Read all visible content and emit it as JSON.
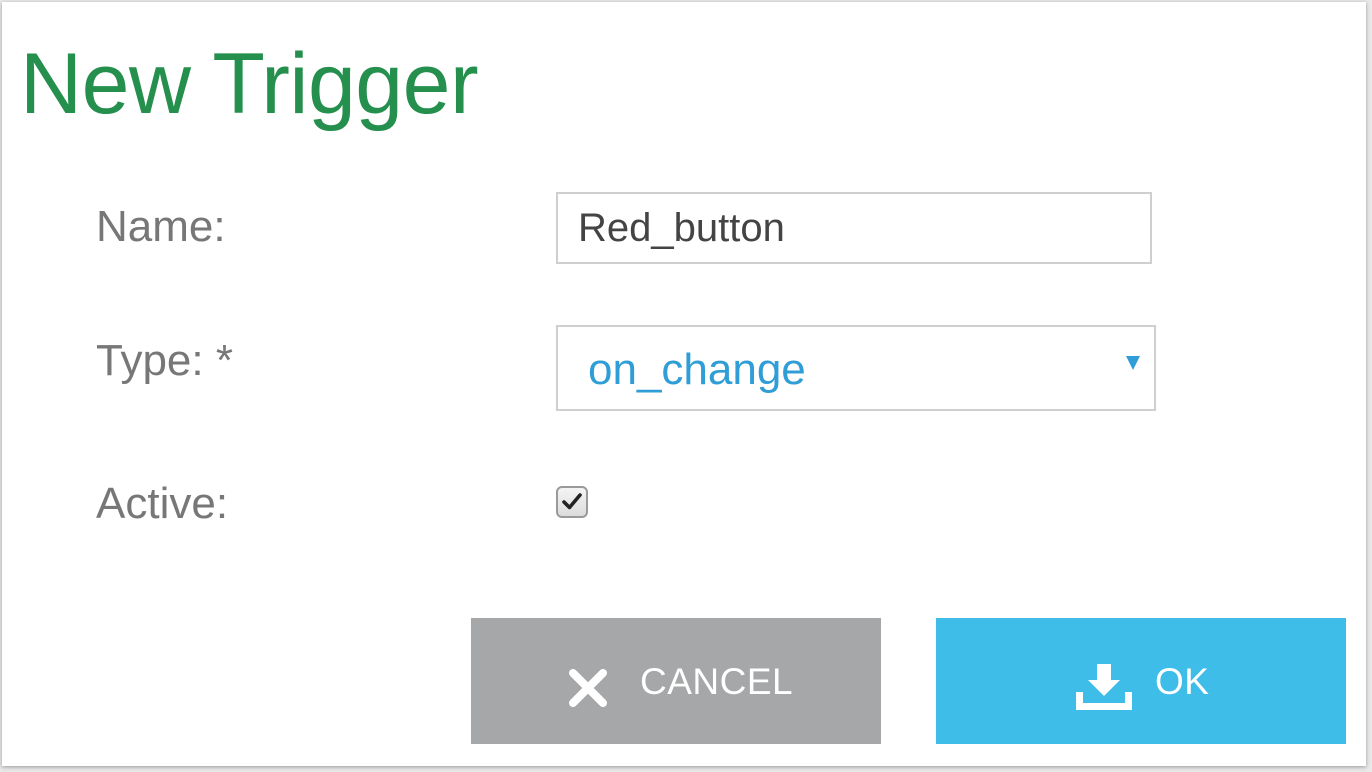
{
  "dialog": {
    "title": "New Trigger"
  },
  "form": {
    "name": {
      "label": "Name:",
      "value": "Red_button"
    },
    "type": {
      "label": "Type: *",
      "selected": "on_change"
    },
    "active": {
      "label": "Active:",
      "checked": true
    }
  },
  "buttons": {
    "cancel": {
      "label": "CANCEL",
      "icon": "close-icon"
    },
    "ok": {
      "label": "OK",
      "icon": "download-icon"
    }
  },
  "colors": {
    "title": "#258f4e",
    "accent": "#2f9ed6",
    "cancel_bg": "#a6a7a8",
    "ok_bg": "#3fbde9"
  }
}
